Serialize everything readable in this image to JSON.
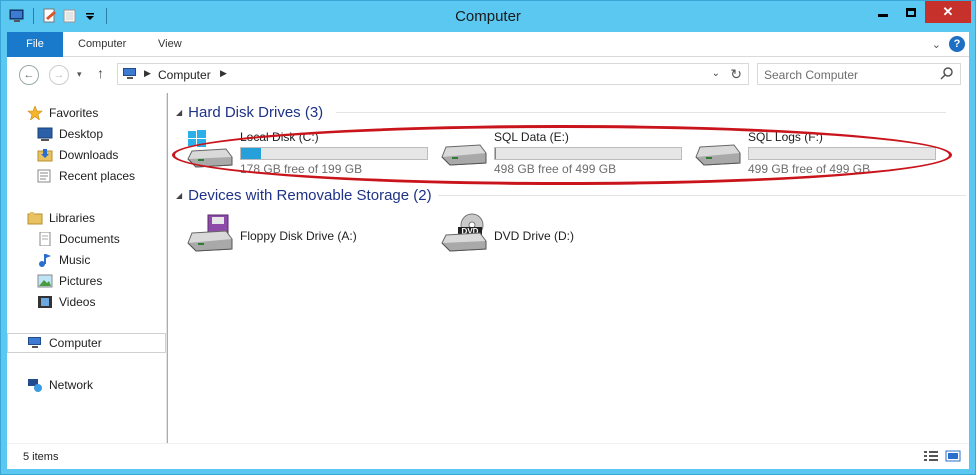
{
  "window": {
    "title": "Computer"
  },
  "ribbon": {
    "tabs": [
      "File",
      "Computer",
      "View"
    ]
  },
  "address": {
    "path": [
      "Computer"
    ]
  },
  "search": {
    "placeholder": "Search Computer"
  },
  "nav": {
    "favorites": {
      "label": "Favorites",
      "items": [
        "Desktop",
        "Downloads",
        "Recent places"
      ]
    },
    "libraries": {
      "label": "Libraries",
      "items": [
        "Documents",
        "Music",
        "Pictures",
        "Videos"
      ]
    },
    "computer": "Computer",
    "network": "Network"
  },
  "groups": {
    "hdd": {
      "header": "Hard Disk Drives (3)",
      "drives": [
        {
          "name": "Local Disk (C:)",
          "free": "178 GB free of 199 GB",
          "used_fraction": 0.106
        },
        {
          "name": "SQL Data (E:)",
          "free": "498 GB free of 499 GB",
          "used_fraction": 0.002
        },
        {
          "name": "SQL Logs (F:)",
          "free": "499 GB free of 499 GB",
          "used_fraction": 0.0
        }
      ]
    },
    "removable": {
      "header": "Devices with Removable Storage (2)",
      "devices": [
        "Floppy Disk Drive (A:)",
        "DVD Drive (D:)"
      ],
      "dvd_badge": "DVD"
    }
  },
  "status": {
    "count": "5 items"
  },
  "colors": {
    "titlebar": "#5ac8f0",
    "file_tab": "#1979ca",
    "bar_fill": "#26a0da",
    "highlight": "#c9141b"
  }
}
